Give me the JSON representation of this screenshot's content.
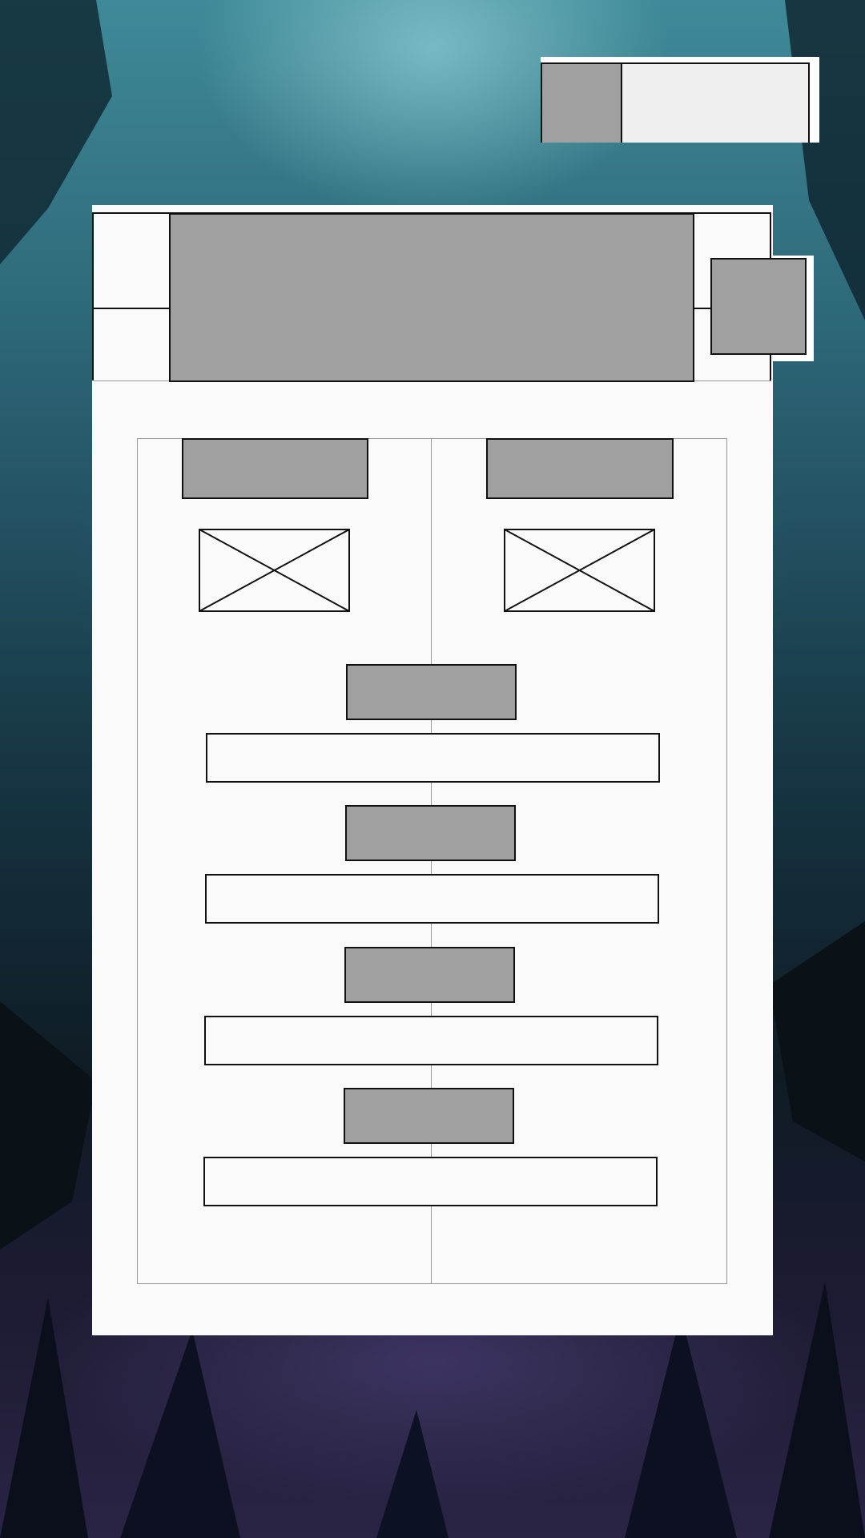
{
  "screen": {
    "background": "dark-forest-illustration",
    "colors": {
      "panel": "#fafafa",
      "placeholder": "#a0a0a0",
      "outline": "#111111",
      "divider": "#999999"
    }
  },
  "top_badge": {
    "icon": "avatar-placeholder-icon",
    "value": ""
  },
  "dialog": {
    "title": "",
    "close_icon": "close-placeholder-icon",
    "columns": [
      {
        "label": "",
        "image_icon": "image-placeholder-icon"
      },
      {
        "label": "",
        "image_icon": "image-placeholder-icon"
      }
    ],
    "rows": [
      {
        "label": "",
        "value": ""
      },
      {
        "label": "",
        "value": ""
      },
      {
        "label": "",
        "value": ""
      },
      {
        "label": "",
        "value": ""
      }
    ]
  }
}
